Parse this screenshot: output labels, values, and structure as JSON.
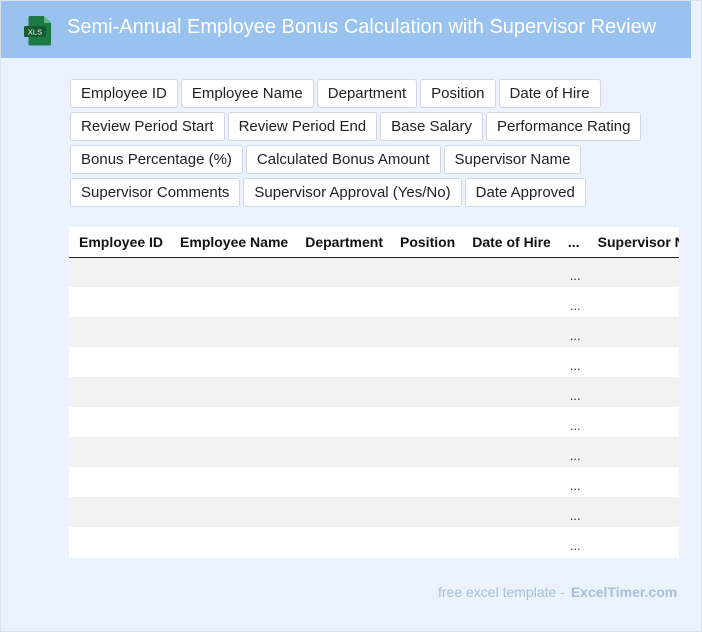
{
  "header": {
    "icon_label": "XLS",
    "title": "Semi-Annual Employee Bonus Calculation with Supervisor Review"
  },
  "fields": [
    "Employee ID",
    "Employee Name",
    "Department",
    "Position",
    "Date of Hire",
    "Review Period Start",
    "Review Period End",
    "Base Salary",
    "Performance Rating",
    "Bonus Percentage (%)",
    "Calculated Bonus Amount",
    "Supervisor Name",
    "Supervisor Comments",
    "Supervisor Approval (Yes/No)",
    "Date Approved"
  ],
  "table": {
    "columns": [
      "Employee ID",
      "Employee Name",
      "Department",
      "Position",
      "Date of Hire",
      "...",
      "Supervisor Name"
    ],
    "row_placeholder": "...",
    "row_count": 10
  },
  "footer": {
    "text": "free excel template -",
    "brand": "ExcelTimer.com"
  },
  "colors": {
    "header_bg": "#99c3ee",
    "page_bg": "#eaf3fd",
    "icon_green": "#1e7a45"
  }
}
